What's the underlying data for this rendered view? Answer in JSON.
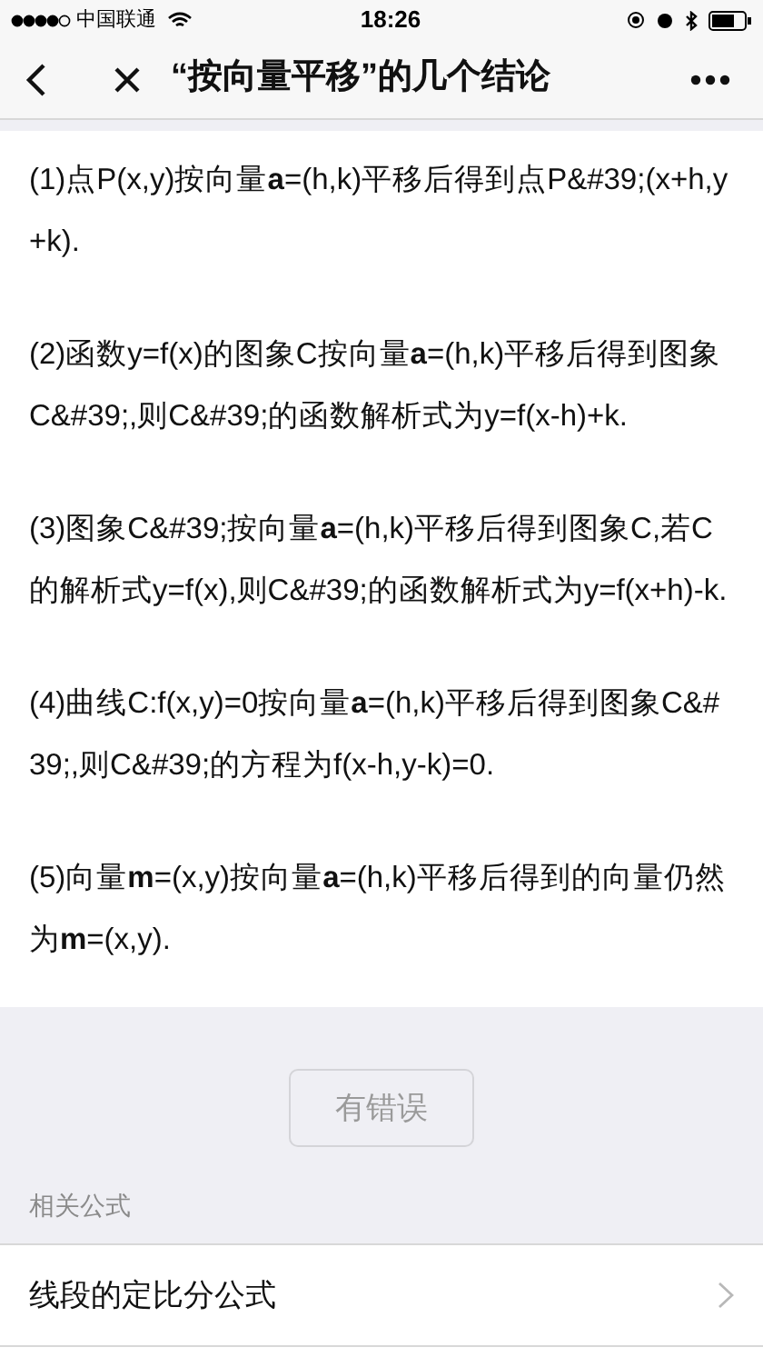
{
  "status_bar": {
    "carrier": "中国联通",
    "time": "18:26"
  },
  "nav": {
    "title": "“按向量平移”的几个结论"
  },
  "paragraphs": [
    "(1)点P(x,y)按向量**a**=(h,k)平移后得到点P&#39;(x+h,y+k).",
    "(2)函数y=f(x)的图象C按向量**a**=(h,k)平移后得到图象C&#39;,则C&#39;的函数解析式为y=f(x-h)+k.",
    "(3)图象C&#39;按向量**a**=(h,k)平移后得到图象C,若C的解析式y=f(x),则C&#39;的函数解析式为y=f(x+h)-k.",
    "(4)曲线C:f(x,y)=0按向量**a**=(h,k)平移后得到图象C&#39;,则C&#39;的方程为f(x-h,y-k)=0.",
    "(5)向量**m**=(x,y)按向量**a**=(h,k)平移后得到的向量仍然为**m**=(x,y)."
  ],
  "error_button": {
    "label": "有错误",
    "disabled": true
  },
  "related": {
    "heading": "相关公式",
    "items": [
      {
        "label": "线段的定比分公式"
      }
    ]
  }
}
